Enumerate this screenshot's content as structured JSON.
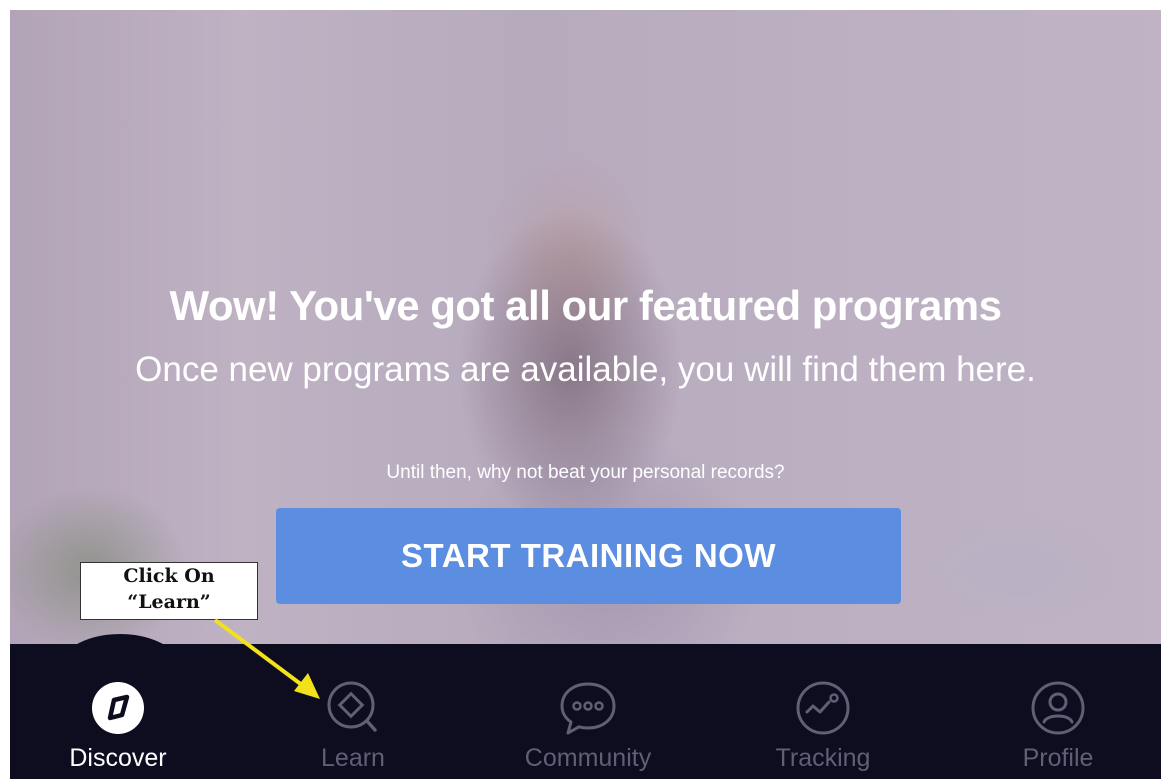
{
  "hero": {
    "headline": "Wow! You've got all our featured programs",
    "subline": "Once new programs are available, you will find them here.",
    "prompt": "Until then, why not beat your personal records?",
    "cta_label": "START TRAINING NOW"
  },
  "nav": {
    "items": [
      {
        "label": "Discover",
        "icon": "compass-icon",
        "active": true
      },
      {
        "label": "Learn",
        "icon": "learn-diamond-icon",
        "active": false
      },
      {
        "label": "Community",
        "icon": "chat-bubble-icon",
        "active": false
      },
      {
        "label": "Tracking",
        "icon": "gauge-icon",
        "active": false
      },
      {
        "label": "Profile",
        "icon": "user-icon",
        "active": false
      }
    ]
  },
  "annotation": {
    "line1": "Click On",
    "line2": "“Learn”"
  },
  "colors": {
    "cta": "#5b8de1",
    "tabbar": "#0d0d1f",
    "inactive_tab": "#5f5f75",
    "arrow": "#f2e21b"
  }
}
